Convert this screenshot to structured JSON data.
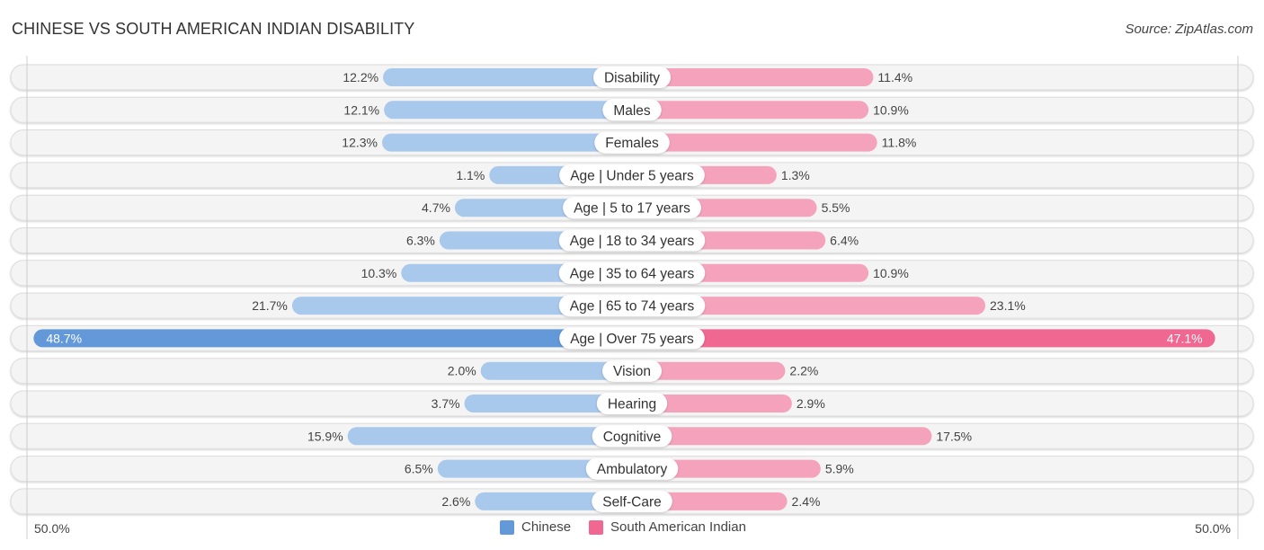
{
  "header": {
    "title": "CHINESE VS SOUTH AMERICAN INDIAN DISABILITY",
    "source": "Source: ZipAtlas.com"
  },
  "colors": {
    "chinese_light": "#a8c8ec",
    "chinese_strong": "#6399d8",
    "sai_light": "#f5a3bd",
    "sai_strong": "#f06892"
  },
  "axis": {
    "left_label": "50.0%",
    "right_label": "50.0%"
  },
  "legend": {
    "items": [
      {
        "label": "Chinese",
        "color": "#6399d8"
      },
      {
        "label": "South American Indian",
        "color": "#f06892"
      }
    ]
  },
  "chart_data": {
    "type": "bar",
    "orientation": "horizontal-diverging",
    "title": "CHINESE VS SOUTH AMERICAN INDIAN DISABILITY",
    "xlabel": "",
    "ylabel": "",
    "xlim": [
      0,
      50
    ],
    "legend_position": "bottom-center",
    "categories": [
      "Disability",
      "Males",
      "Females",
      "Age | Under 5 years",
      "Age | 5 to 17 years",
      "Age | 18 to 34 years",
      "Age | 35 to 64 years",
      "Age | 65 to 74 years",
      "Age | Over 75 years",
      "Vision",
      "Hearing",
      "Cognitive",
      "Ambulatory",
      "Self-Care"
    ],
    "series": [
      {
        "name": "Chinese",
        "side": "left",
        "values": [
          12.2,
          12.1,
          12.3,
          1.1,
          4.7,
          6.3,
          10.3,
          21.7,
          48.7,
          2.0,
          3.7,
          15.9,
          6.5,
          2.6
        ],
        "labels": [
          "12.2%",
          "12.1%",
          "12.3%",
          "1.1%",
          "4.7%",
          "6.3%",
          "10.3%",
          "21.7%",
          "48.7%",
          "2.0%",
          "3.7%",
          "15.9%",
          "6.5%",
          "2.6%"
        ]
      },
      {
        "name": "South American Indian",
        "side": "right",
        "values": [
          11.4,
          10.9,
          11.8,
          1.3,
          5.5,
          6.4,
          10.9,
          23.1,
          47.1,
          2.2,
          2.9,
          17.5,
          5.9,
          2.4
        ],
        "labels": [
          "11.4%",
          "10.9%",
          "11.8%",
          "1.3%",
          "5.5%",
          "6.4%",
          "10.9%",
          "23.1%",
          "47.1%",
          "2.2%",
          "2.9%",
          "17.5%",
          "5.9%",
          "2.4%"
        ]
      }
    ]
  }
}
